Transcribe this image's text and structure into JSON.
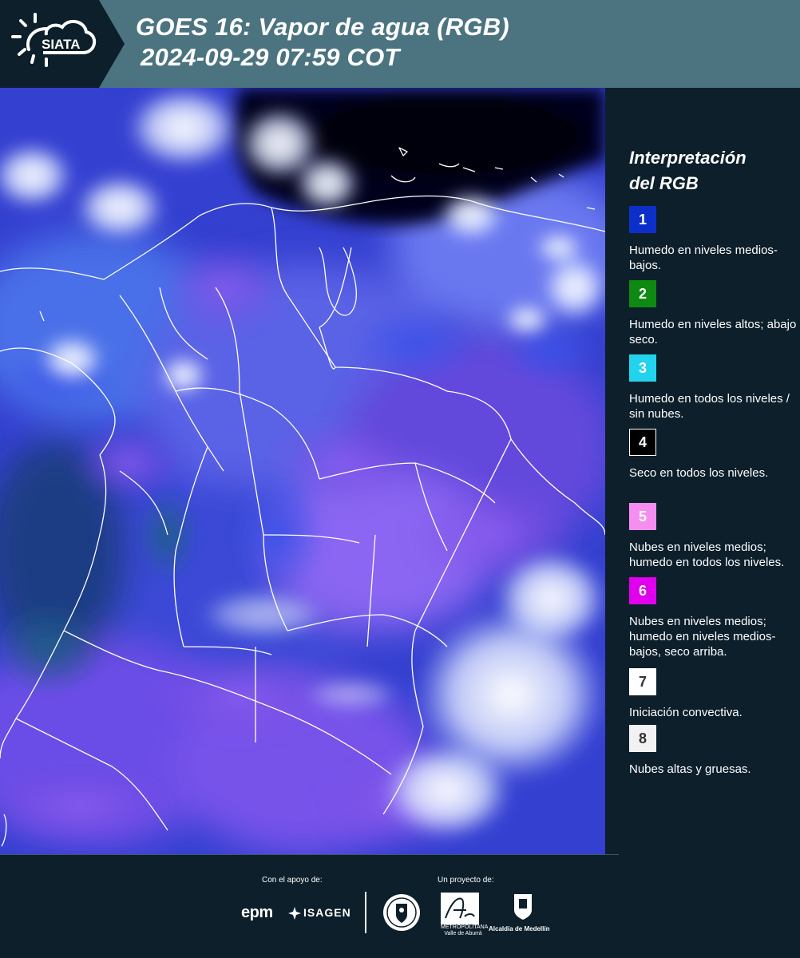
{
  "header": {
    "title_line1": "GOES 16: Vapor de agua (RGB)",
    "title_line2": "2024-09-29 07:59 COT",
    "logo_text": "SIATA"
  },
  "legend": {
    "title_line1": "Interpretación",
    "title_line2": "del RGB",
    "items": [
      {
        "num": "1",
        "color": "#0c2fc9",
        "text_color": "#ffffff",
        "text": "Humedo en niveles medios-bajos."
      },
      {
        "num": "2",
        "color": "#0e8a12",
        "text_color": "#ffffff",
        "text": "Humedo en niveles altos; abajo seco."
      },
      {
        "num": "3",
        "color": "#22d3ee",
        "text_color": "#ffffff",
        "text": "Humedo en todos los niveles / sin nubes."
      },
      {
        "num": "4",
        "color": "#000000",
        "text_color": "#ffffff",
        "text": "Seco en todos los niveles."
      },
      {
        "num": "5",
        "color": "#f58ef0",
        "text_color": "#ffffff",
        "text": "Nubes en niveles medios; humedo en todos los niveles."
      },
      {
        "num": "6",
        "color": "#e000ee",
        "text_color": "#ffffff",
        "text": "Nubes en niveles medios; humedo en niveles medios-bajos, seco arriba."
      },
      {
        "num": "7",
        "color": "#ffffff",
        "text_color": "#333333",
        "text": "Iniciación convectiva."
      },
      {
        "num": "8",
        "color": "#f2f2f2",
        "text_color": "#333333",
        "text": "Nubes altas y gruesas."
      }
    ]
  },
  "footer": {
    "support_label": "Con el apoyo de:",
    "project_label": "Un proyecto de:",
    "sponsor1": "epm",
    "sponsor2": "ISAGEN",
    "partner_area": "METROPOLITANA Valle de Aburrá",
    "partner_alcaldia": "Alcaldía de Medellín"
  }
}
